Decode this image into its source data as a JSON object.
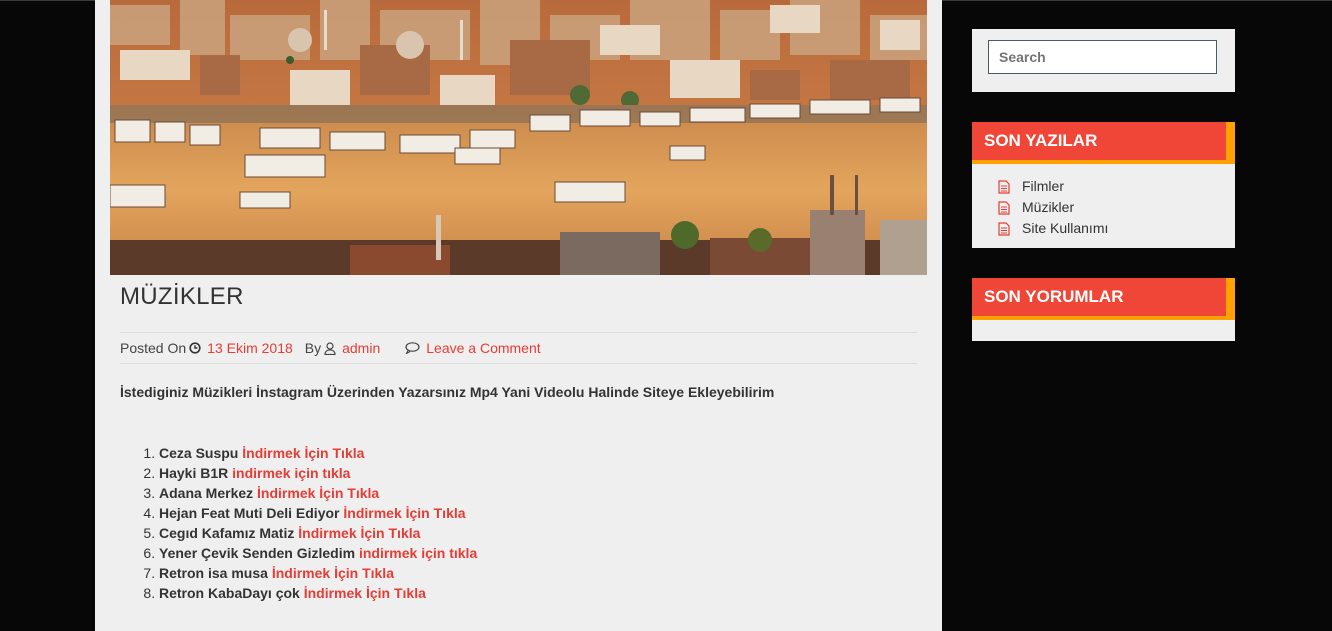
{
  "post": {
    "title": "MÜZİKLER",
    "posted_on_label": "Posted On",
    "date": "13 Ekim 2018",
    "by_label": "By",
    "author": "admin",
    "comment_link": "Leave a Comment",
    "intro": "İstediginiz Müzikleri İnstagram Üzerinden Yazarsınız Mp4 Yani Videolu Halinde Siteye Ekleyebilirim",
    "songs": [
      {
        "name": "Ceza Suspu",
        "link": "İndirmek İçin Tıkla"
      },
      {
        "name": "Hayki B1R",
        "link": "indirmek için tıkla"
      },
      {
        "name": "Adana Merkez",
        "link": "İndirmek İçin Tıkla"
      },
      {
        "name": "Hejan Feat Muti Deli Ediyor",
        "link": "İndirmek İçin Tıkla"
      },
      {
        "name": "Cegıd Kafamız Matiz",
        "link": "İndirmek İçin Tıkla"
      },
      {
        "name": "Yener Çevik Senden Gizledim",
        "link": "indirmek için tıkla"
      },
      {
        "name": "Retron isa musa",
        "link": "İndirmek İçin Tıkla"
      },
      {
        "name": "Retron KabaDayı çok",
        "link": "İndirmek İçin Tıkla"
      }
    ]
  },
  "sidebar": {
    "search_placeholder": "Search",
    "recent_title": "SON YAZILAR",
    "recent_items": [
      "Filmler",
      "Müzikler",
      "Site Kullanımı"
    ],
    "comments_title": "SON YORUMLAR"
  },
  "colors": {
    "accent": "#e53d35",
    "widget_header": "#ef4637",
    "widget_tab": "#ffa200",
    "background": "#070707",
    "content_bg": "#efefef"
  },
  "icons": [
    "clock-icon",
    "user-icon",
    "comment-icon",
    "document-icon"
  ]
}
